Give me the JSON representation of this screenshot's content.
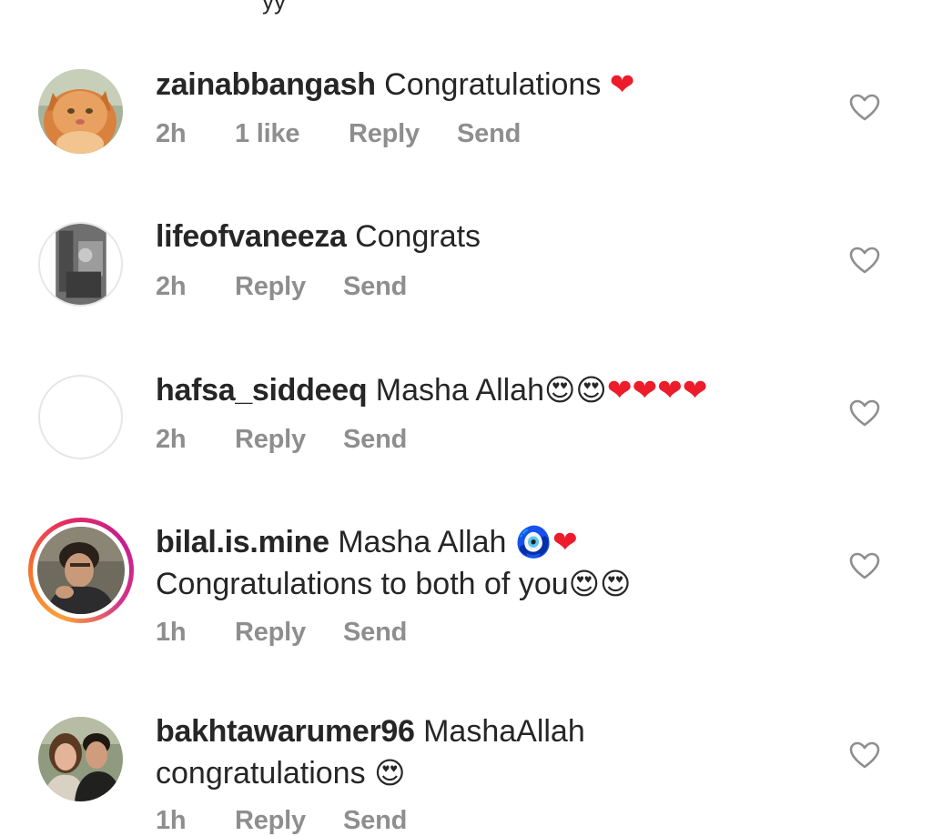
{
  "top_cropped_text": "yy",
  "comments": [
    {
      "username": "zainabbangash",
      "text": "Congratulations",
      "emojis": [
        "❤"
      ],
      "time": "2h",
      "likes": "1 like",
      "reply": "Reply",
      "send": "Send",
      "avatar": "cat-photo"
    },
    {
      "username": "lifeofvaneeza",
      "text": "Congrats",
      "emojis": [],
      "time": "2h",
      "reply": "Reply",
      "send": "Send",
      "avatar": "grayscale-photo"
    },
    {
      "username": "hafsa_siddeeq",
      "text": "Masha Allah",
      "emojis": [
        "😍",
        "😍",
        "❤",
        "❤",
        "❤",
        "❤"
      ],
      "time": "2h",
      "reply": "Reply",
      "send": "Send",
      "avatar": "empty"
    },
    {
      "username": "bilal.is.mine",
      "text": "Masha Allah",
      "emojis": [
        "🧿",
        "❤"
      ],
      "text_line2": "Congratulations to both of you",
      "emojis_line2": [
        "😍",
        "😍"
      ],
      "time": "1h",
      "reply": "Reply",
      "send": "Send",
      "avatar": "man-photo-with-story-ring"
    },
    {
      "username": "bakhtawarumer96",
      "text": "MashaAllah",
      "text_line2": "congratulations",
      "emojis_line2": [
        "😍"
      ],
      "time": "1h",
      "reply": "Reply",
      "send": "Send",
      "avatar": "couple-photo"
    }
  ],
  "icons": {
    "like": "heart-outline-icon"
  },
  "colors": {
    "text": "#262626",
    "meta": "#8e8e8e",
    "heart_emoji": "#ed1c2b",
    "story_ring_start": "#f9a13a",
    "story_ring_end": "#c41f8f"
  }
}
